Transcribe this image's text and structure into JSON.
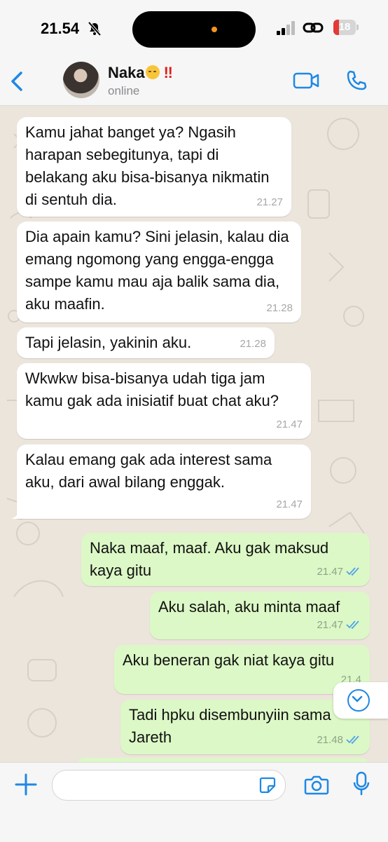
{
  "status_bar": {
    "time": "21.54",
    "battery": "18"
  },
  "header": {
    "name": "Naka",
    "emphasis": "‼",
    "status": "online"
  },
  "messages": [
    {
      "side": "in",
      "text": "Kamu jahat banget ya? Ngasih harapan sebegitunya, tapi di belakang aku bisa-bisanya nikmatin di sentuh dia.",
      "time": "21.27"
    },
    {
      "side": "in",
      "text": "Dia apain kamu? Sini jelasin, kalau dia emang ngomong yang engga-engga sampe kamu mau aja balik sama dia, aku maafin.",
      "time": "21.28"
    },
    {
      "side": "in",
      "text": "Tapi jelasin, yakinin aku.",
      "time": "21.28"
    },
    {
      "side": "in",
      "text": "Wkwkw bisa-bisanya udah tiga jam kamu gak ada inisiatif buat chat aku?",
      "time": "21.47"
    },
    {
      "side": "in",
      "text": "Kalau emang gak ada interest sama aku, dari awal bilang enggak.",
      "time": "21.47"
    },
    {
      "side": "out",
      "text": "Naka maaf, maaf. Aku gak maksud kaya gitu",
      "time": "21.47"
    },
    {
      "side": "out",
      "text": "Aku salah, aku minta maaf",
      "time": "21.47"
    },
    {
      "side": "out",
      "text": "Aku beneran gak niat kaya gitu",
      "time": "21.4"
    },
    {
      "side": "out",
      "text": "Tadi hpku disembunyiin sama Jareth",
      "time": "21.48"
    }
  ],
  "colors": {
    "accent": "#1e88e5",
    "outgoing_bubble": "#dcf8c6",
    "incoming_bubble": "#ffffff",
    "battery_low": "#e53935"
  }
}
